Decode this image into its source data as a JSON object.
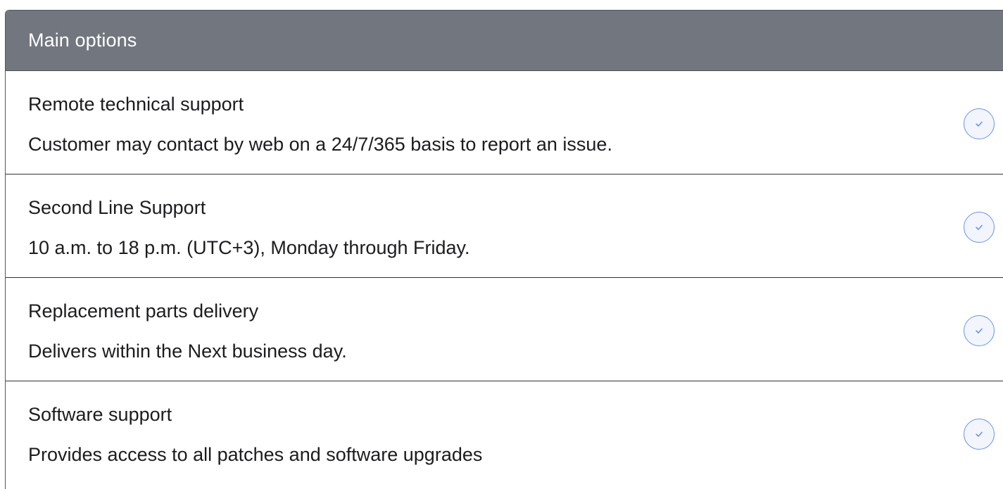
{
  "panel": {
    "title": "Main options"
  },
  "options": [
    {
      "title": "Remote technical support",
      "description": "Customer may contact by web on a 24/7/365 basis to report an issue.",
      "icon": "check-circle-icon",
      "checked": true
    },
    {
      "title": "Second Line Support",
      "description": "10 a.m. to 18 p.m. (UTC+3), Monday through Friday.",
      "icon": "check-circle-icon",
      "checked": true
    },
    {
      "title": "Replacement parts delivery",
      "description": "Delivers within the Next business day.",
      "icon": "check-circle-icon",
      "checked": true
    },
    {
      "title": "Software support",
      "description": "Provides access to all patches and software upgrades",
      "icon": "check-circle-icon",
      "checked": true
    }
  ],
  "colors": {
    "header_bg": "#72767e",
    "header_text": "#ffffff",
    "check_accent": "#6b93e6"
  }
}
